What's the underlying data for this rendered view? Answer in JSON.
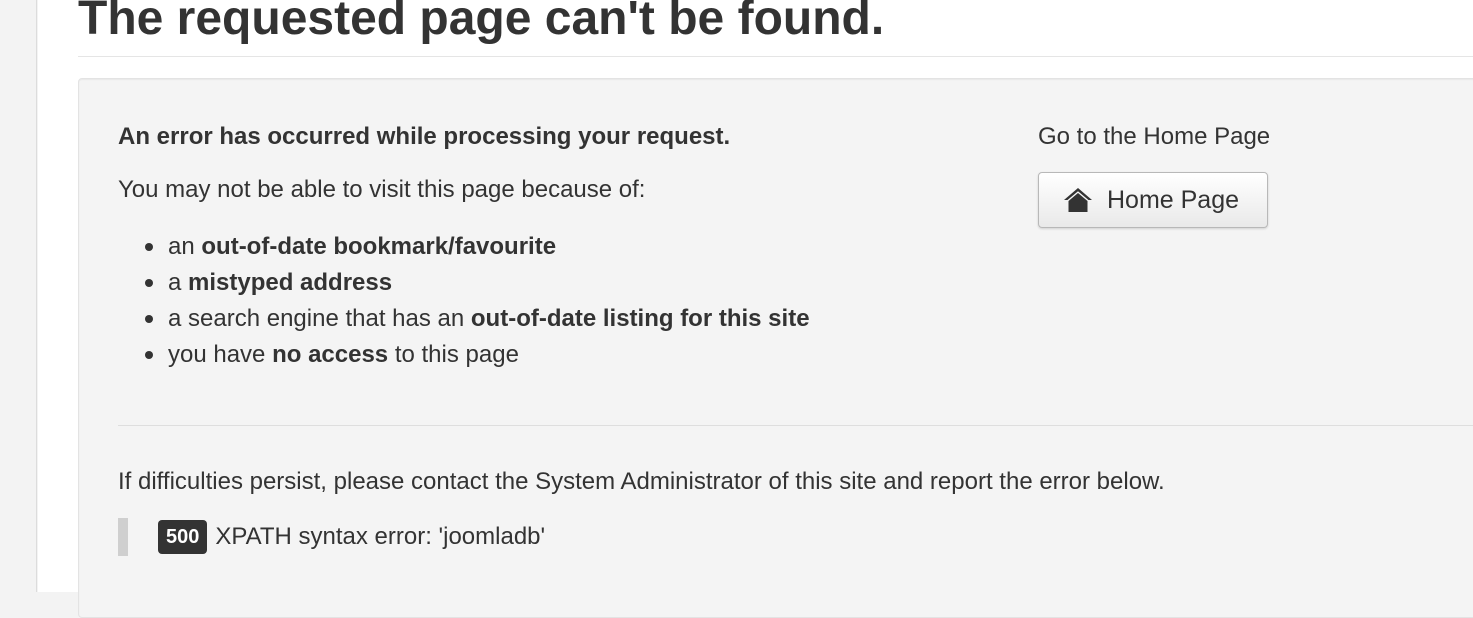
{
  "page": {
    "title": "The requested page can't be found."
  },
  "error_panel": {
    "heading": "An error has occurred while processing your request.",
    "reasons_intro": "You may not be able to visit this page because of:",
    "reasons": [
      {
        "prefix": "an ",
        "bold": "out-of-date bookmark/favourite",
        "suffix": ""
      },
      {
        "prefix": "a ",
        "bold": "mistyped address",
        "suffix": ""
      },
      {
        "prefix": "a search engine that has an ",
        "bold": "out-of-date listing for this site",
        "suffix": ""
      },
      {
        "prefix": "you have ",
        "bold": "no access",
        "suffix": " to this page"
      }
    ]
  },
  "home": {
    "intro": "Go to the Home Page",
    "button_label": "Home Page",
    "icon": "home-icon"
  },
  "contact": {
    "text": "If difficulties persist, please contact the System Administrator of this site and report the error below."
  },
  "error": {
    "code": "500",
    "message": "XPATH syntax error: 'joomladb'"
  },
  "colors": {
    "text": "#333333",
    "well_background": "#f4f4f4",
    "badge_background": "#333333",
    "badge_text": "#ffffff"
  }
}
